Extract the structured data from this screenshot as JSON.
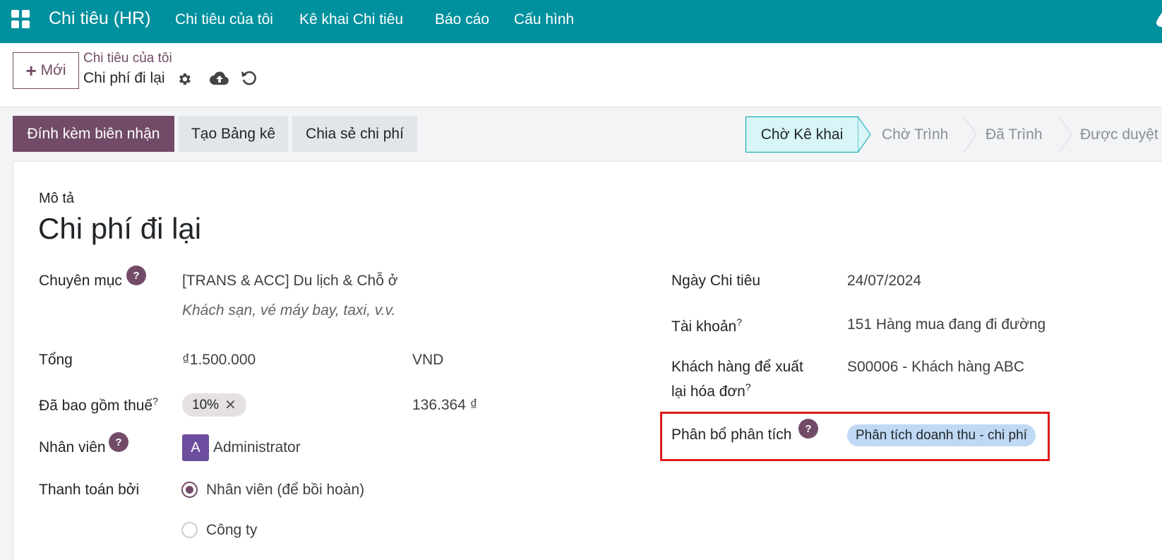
{
  "navbar": {
    "brand": "Chi tiêu (HR)",
    "menu": [
      "Chi tiêu của tôi",
      "Kê khai Chi tiêu",
      "Báo cáo",
      "Cấu hình"
    ]
  },
  "control": {
    "new_label": "Mới",
    "breadcrumb_parent": "Chi tiêu của tôi",
    "breadcrumb_current": "Chi phí đi lại"
  },
  "actions": {
    "attach_receipt": "Đính kèm biên nhận",
    "create_report": "Tạo Bảng kê",
    "split_expense": "Chia sẻ chi phí"
  },
  "status": {
    "stages": [
      "Chờ Kê khai",
      "Chờ Trình",
      "Đã Trình",
      "Được duyệt"
    ],
    "active": "Chờ Kê khai"
  },
  "form": {
    "description_label": "Mô tả",
    "title": "Chi phí đi lại",
    "category_label": "Chuyên mục",
    "category_value": "[TRANS & ACC] Du lịch & Chỗ ở",
    "category_hint": "Khách sạn, vé máy bay, taxi, v.v.",
    "total_label": "Tổng",
    "total_value": "₫1.500.000",
    "currency": "VND",
    "tax_label": "Đã bao gồm thuế",
    "tax_tag": "10%",
    "tax_amount": "136.364 ₫",
    "employee_label": "Nhân viên",
    "employee_initial": "A",
    "employee_value": "Administrator",
    "paid_by_label": "Thanh toán bởi",
    "paid_by_options": [
      "Nhân viên (để bồi hoàn)",
      "Công ty"
    ],
    "date_label": "Ngày Chi tiêu",
    "date_value": "24/07/2024",
    "account_label": "Tài khoản",
    "account_value": "151 Hàng mua đang đi đường",
    "customer_label_1": "Khách hàng để xuất",
    "customer_label_2": "lại hóa đơn",
    "customer_value": "S00006 - Khách hàng ABC",
    "analytic_label": "Phân bổ phân tích",
    "analytic_tag": "Phân tích doanh thu - chi phí",
    "help_mark": "?"
  },
  "colors": {
    "navbar": "#00909e",
    "primary": "#714b67",
    "highlight": "#e01b1b"
  }
}
